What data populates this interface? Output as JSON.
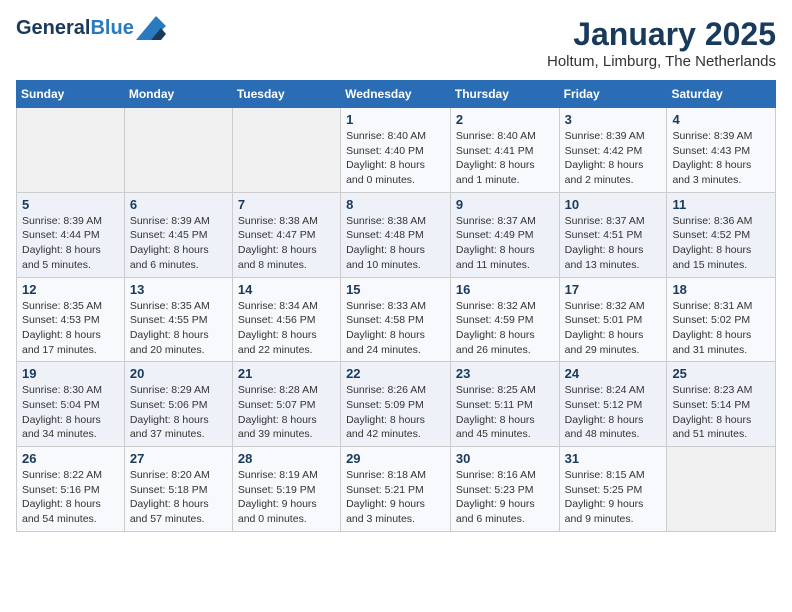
{
  "header": {
    "logo_line1": "General",
    "logo_line2": "Blue",
    "month": "January 2025",
    "location": "Holtum, Limburg, The Netherlands"
  },
  "weekdays": [
    "Sunday",
    "Monday",
    "Tuesday",
    "Wednesday",
    "Thursday",
    "Friday",
    "Saturday"
  ],
  "weeks": [
    [
      {
        "day": "",
        "info": ""
      },
      {
        "day": "",
        "info": ""
      },
      {
        "day": "",
        "info": ""
      },
      {
        "day": "1",
        "info": "Sunrise: 8:40 AM\nSunset: 4:40 PM\nDaylight: 8 hours\nand 0 minutes."
      },
      {
        "day": "2",
        "info": "Sunrise: 8:40 AM\nSunset: 4:41 PM\nDaylight: 8 hours\nand 1 minute."
      },
      {
        "day": "3",
        "info": "Sunrise: 8:39 AM\nSunset: 4:42 PM\nDaylight: 8 hours\nand 2 minutes."
      },
      {
        "day": "4",
        "info": "Sunrise: 8:39 AM\nSunset: 4:43 PM\nDaylight: 8 hours\nand 3 minutes."
      }
    ],
    [
      {
        "day": "5",
        "info": "Sunrise: 8:39 AM\nSunset: 4:44 PM\nDaylight: 8 hours\nand 5 minutes."
      },
      {
        "day": "6",
        "info": "Sunrise: 8:39 AM\nSunset: 4:45 PM\nDaylight: 8 hours\nand 6 minutes."
      },
      {
        "day": "7",
        "info": "Sunrise: 8:38 AM\nSunset: 4:47 PM\nDaylight: 8 hours\nand 8 minutes."
      },
      {
        "day": "8",
        "info": "Sunrise: 8:38 AM\nSunset: 4:48 PM\nDaylight: 8 hours\nand 10 minutes."
      },
      {
        "day": "9",
        "info": "Sunrise: 8:37 AM\nSunset: 4:49 PM\nDaylight: 8 hours\nand 11 minutes."
      },
      {
        "day": "10",
        "info": "Sunrise: 8:37 AM\nSunset: 4:51 PM\nDaylight: 8 hours\nand 13 minutes."
      },
      {
        "day": "11",
        "info": "Sunrise: 8:36 AM\nSunset: 4:52 PM\nDaylight: 8 hours\nand 15 minutes."
      }
    ],
    [
      {
        "day": "12",
        "info": "Sunrise: 8:35 AM\nSunset: 4:53 PM\nDaylight: 8 hours\nand 17 minutes."
      },
      {
        "day": "13",
        "info": "Sunrise: 8:35 AM\nSunset: 4:55 PM\nDaylight: 8 hours\nand 20 minutes."
      },
      {
        "day": "14",
        "info": "Sunrise: 8:34 AM\nSunset: 4:56 PM\nDaylight: 8 hours\nand 22 minutes."
      },
      {
        "day": "15",
        "info": "Sunrise: 8:33 AM\nSunset: 4:58 PM\nDaylight: 8 hours\nand 24 minutes."
      },
      {
        "day": "16",
        "info": "Sunrise: 8:32 AM\nSunset: 4:59 PM\nDaylight: 8 hours\nand 26 minutes."
      },
      {
        "day": "17",
        "info": "Sunrise: 8:32 AM\nSunset: 5:01 PM\nDaylight: 8 hours\nand 29 minutes."
      },
      {
        "day": "18",
        "info": "Sunrise: 8:31 AM\nSunset: 5:02 PM\nDaylight: 8 hours\nand 31 minutes."
      }
    ],
    [
      {
        "day": "19",
        "info": "Sunrise: 8:30 AM\nSunset: 5:04 PM\nDaylight: 8 hours\nand 34 minutes."
      },
      {
        "day": "20",
        "info": "Sunrise: 8:29 AM\nSunset: 5:06 PM\nDaylight: 8 hours\nand 37 minutes."
      },
      {
        "day": "21",
        "info": "Sunrise: 8:28 AM\nSunset: 5:07 PM\nDaylight: 8 hours\nand 39 minutes."
      },
      {
        "day": "22",
        "info": "Sunrise: 8:26 AM\nSunset: 5:09 PM\nDaylight: 8 hours\nand 42 minutes."
      },
      {
        "day": "23",
        "info": "Sunrise: 8:25 AM\nSunset: 5:11 PM\nDaylight: 8 hours\nand 45 minutes."
      },
      {
        "day": "24",
        "info": "Sunrise: 8:24 AM\nSunset: 5:12 PM\nDaylight: 8 hours\nand 48 minutes."
      },
      {
        "day": "25",
        "info": "Sunrise: 8:23 AM\nSunset: 5:14 PM\nDaylight: 8 hours\nand 51 minutes."
      }
    ],
    [
      {
        "day": "26",
        "info": "Sunrise: 8:22 AM\nSunset: 5:16 PM\nDaylight: 8 hours\nand 54 minutes."
      },
      {
        "day": "27",
        "info": "Sunrise: 8:20 AM\nSunset: 5:18 PM\nDaylight: 8 hours\nand 57 minutes."
      },
      {
        "day": "28",
        "info": "Sunrise: 8:19 AM\nSunset: 5:19 PM\nDaylight: 9 hours\nand 0 minutes."
      },
      {
        "day": "29",
        "info": "Sunrise: 8:18 AM\nSunset: 5:21 PM\nDaylight: 9 hours\nand 3 minutes."
      },
      {
        "day": "30",
        "info": "Sunrise: 8:16 AM\nSunset: 5:23 PM\nDaylight: 9 hours\nand 6 minutes."
      },
      {
        "day": "31",
        "info": "Sunrise: 8:15 AM\nSunset: 5:25 PM\nDaylight: 9 hours\nand 9 minutes."
      },
      {
        "day": "",
        "info": ""
      }
    ]
  ]
}
